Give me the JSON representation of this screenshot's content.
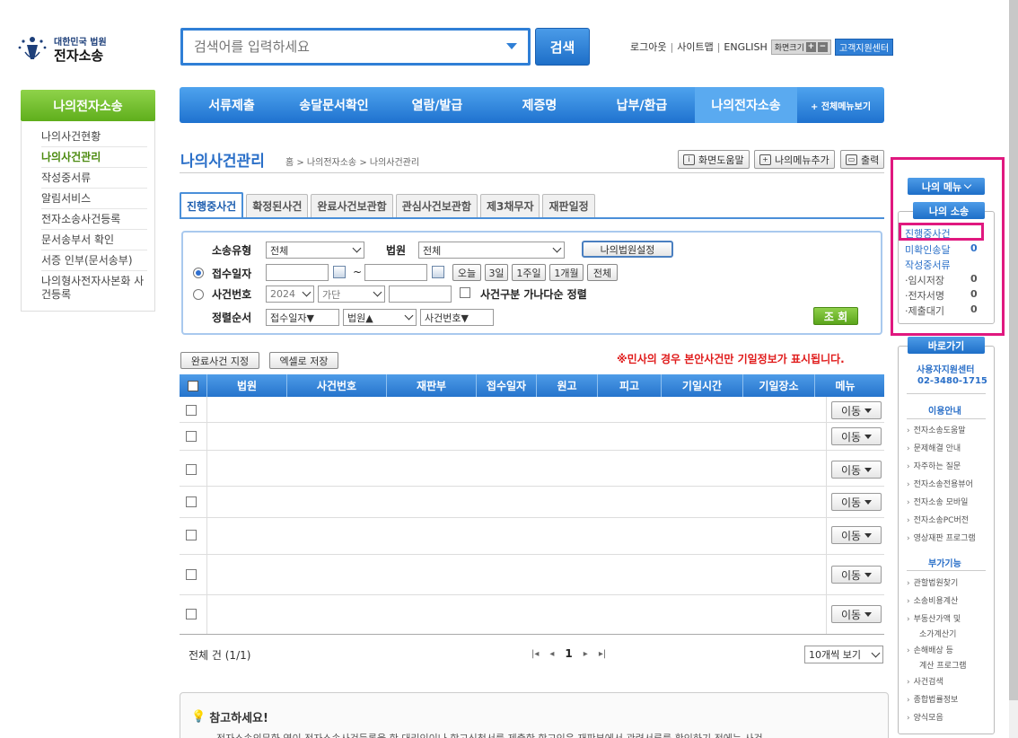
{
  "header": {
    "logo_line1": "대한민국 법원",
    "logo_line2": "전자소송",
    "search_placeholder": "검색어를 입력하세요",
    "search_button": "검색",
    "util": {
      "logout": "로그아웃",
      "sitemap": "사이트맵",
      "english": "ENGLISH",
      "font_size": "화면크기",
      "help_center": "고객지원센터"
    }
  },
  "gnb": {
    "items": [
      "서류제출",
      "송달문서확인",
      "열람/발급",
      "제증명",
      "납부/환급",
      "나의전자소송"
    ],
    "all_menu": "+ 전체메뉴보기"
  },
  "lnb": {
    "title": "나의전자소송",
    "items": [
      "나의사건현황",
      "나의사건관리",
      "작성중서류",
      "알림서비스",
      "전자소송사건등록",
      "문서송부서 확인",
      "서증 인부(문서송부)",
      "나의형사전자사본화 사건등록"
    ],
    "active_index": 1
  },
  "page": {
    "title": "나의사건관리",
    "breadcrumb": "홈 > 나의전자소송 > 나의사건관리",
    "btn_help": "화면도움말",
    "btn_addmenu": "나의메뉴추가",
    "btn_print": "출력"
  },
  "tabs": [
    "진행중사건",
    "확정된사건",
    "완료사건보관함",
    "관심사건보관함",
    "제3채무자",
    "재판일정"
  ],
  "search": {
    "type_label": "소송유형",
    "type_value": "전체",
    "court_label": "법원",
    "court_value": "전체",
    "my_court_btn": "나의법원설정",
    "date_label": "접수일자",
    "tilde": "~",
    "btn_today": "오늘",
    "btn_3d": "3일",
    "btn_1w": "1주일",
    "btn_1m": "1개월",
    "btn_all": "전체",
    "caseno_label": "사건번호",
    "year_value": "2024",
    "kind_value": "가단",
    "sort_chk_label": "사건구분 가나다순 정렬",
    "order_label": "정렬순서",
    "order1": "접수일자▼",
    "order2": "법원▲",
    "order3": "사건번호▼",
    "go_button": "조 회"
  },
  "actions": {
    "btn_complete": "완료사건 지정",
    "btn_excel": "엑셀로 저장",
    "warning": "※민사의 경우 본안사건만 기일정보가 표시됩니다."
  },
  "table": {
    "headers": [
      "법원",
      "사건번호",
      "재판부",
      "접수일자",
      "원고",
      "피고",
      "기일시간",
      "기일장소",
      "메뉴"
    ],
    "move_label": "이동",
    "total": "전체  건 (1/1)",
    "page_current": "1",
    "per_page": "10개씩 보기"
  },
  "notice": {
    "title": "참고하세요!",
    "text": "전자소송의무화 영이 전자소송사건등록을 한 대리인이나 항고신청서를 제출한 항고인은 재판부에서 관련서류를 확인하기 전에는 사건"
  },
  "right": {
    "my_menu": "나의 메뉴",
    "my_suit": "나의 소송",
    "items": [
      {
        "label": "진행중사건",
        "count": ""
      },
      {
        "label": "미확인송달",
        "count": "0"
      },
      {
        "label": "작성중서류",
        "count": ""
      }
    ],
    "subitems": [
      {
        "label": "·임시저장",
        "count": "0"
      },
      {
        "label": "·전자서명",
        "count": "0"
      },
      {
        "label": "·제출대기",
        "count": "0"
      }
    ],
    "quick": "바로가기",
    "center_name": "사용자지원센터",
    "center_phone": "02-3480-1715",
    "guide_title": "이용안내",
    "guide": [
      "전자소송도움말",
      "문제해결 안내",
      "자주하는 질문",
      "전자소송전용뷰어",
      "전자소송 모바일",
      "전자소송PC버전",
      "영상재판 프로그램"
    ],
    "extra_title": "부가기능",
    "extra": [
      "관할법원찾기",
      "소송비용계산",
      "부동산가액 및",
      "소가계산기",
      "손해배상 등",
      "계산 프로그램",
      "사건검색",
      "종합법률정보",
      "양식모음"
    ]
  },
  "colors": {
    "primary_blue": "#2674cc",
    "green": "#5fae1c",
    "highlight_pink": "#e0187f",
    "warning_red": "#e01b1b"
  }
}
